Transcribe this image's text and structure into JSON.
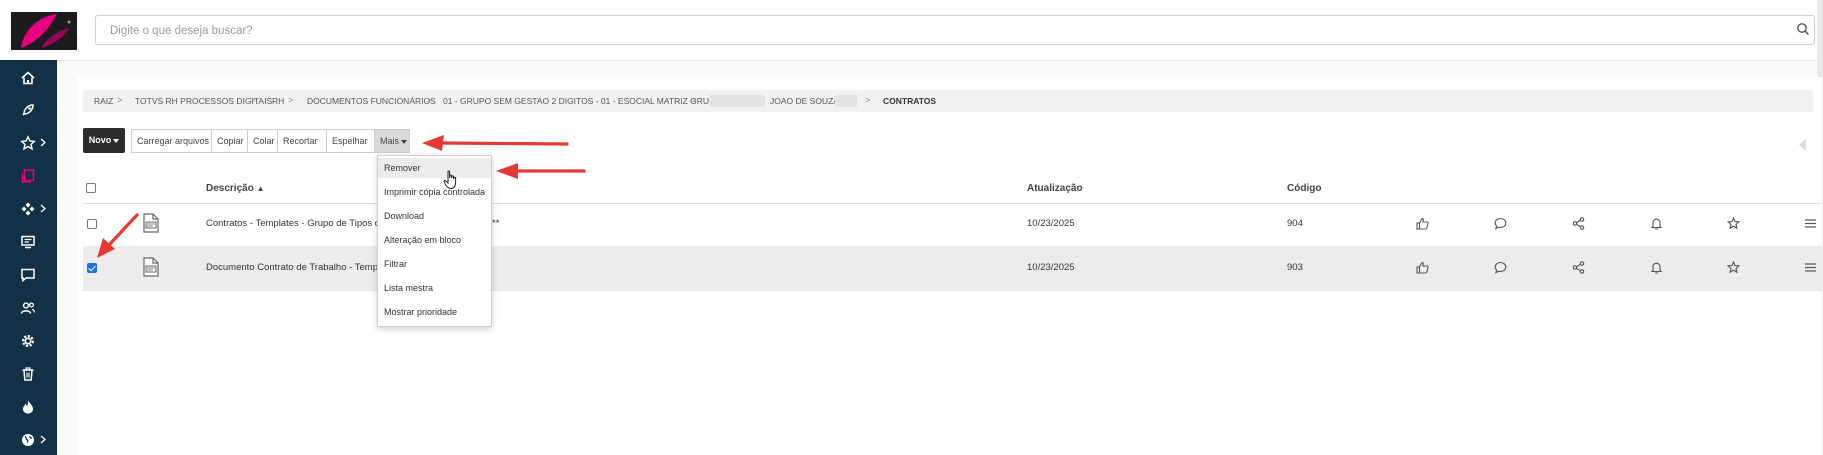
{
  "search": {
    "placeholder": "Digite o que deseja buscar?"
  },
  "sidebar": {
    "items": [
      {
        "icon": "home-icon"
      },
      {
        "icon": "rocket-icon"
      },
      {
        "icon": "star-icon",
        "expandable": true
      },
      {
        "icon": "documents-icon",
        "active": true
      },
      {
        "icon": "workflow-icon",
        "expandable": true
      },
      {
        "icon": "monitor-icon"
      },
      {
        "icon": "chat-icon"
      },
      {
        "icon": "users-icon"
      },
      {
        "icon": "gear-icon"
      },
      {
        "icon": "trash-icon"
      },
      {
        "icon": "flame-icon"
      },
      {
        "icon": "globe-icon",
        "expandable": true
      }
    ]
  },
  "breadcrumb": {
    "items": [
      "RAIZ",
      "TOTVS RH PROCESSOS DIGITAIS",
      "RH",
      "DOCUMENTOS FUNCIONÁRIOS",
      "01 - GRUPO SEM GESTAO 2 DIGITOS - 01 - ESOCIAL MATRIZ GRUPO FF",
      "JOAO DE SOUZA C",
      "CONTRATOS"
    ]
  },
  "toolbar": {
    "novo": "Novo",
    "carregar": "Carregar arquivos",
    "copiar": "Copiar",
    "colar": "Colar",
    "recortar": "Recortar",
    "espelhar": "Espelhar",
    "mais": "Mais"
  },
  "menu": {
    "items": [
      "Remover",
      "Imprimir cópia controlada",
      "Download",
      "Alteração em bloco",
      "Filtrar",
      "Lista mestra",
      "Mostrar prioridade"
    ]
  },
  "table": {
    "headers": {
      "descricao": "Descrição",
      "atualizacao": "Atualização",
      "codigo": "Código"
    },
    "rows": [
      {
        "descricao": "Contratos - Templates - Grupo de Tipos d",
        "descricao_tail": "**",
        "atualizacao": "10/23/2025",
        "codigo": "904",
        "checked": false
      },
      {
        "descricao": "Documento Contrato de Trabalho - Temp",
        "atualizacao": "10/23/2025",
        "codigo": "903",
        "checked": true
      }
    ]
  },
  "colors": {
    "sidebar": "#123046",
    "accent_pink": "#e6007e",
    "annotation_red": "#e53935",
    "novo_button": "#2b2b2b"
  }
}
